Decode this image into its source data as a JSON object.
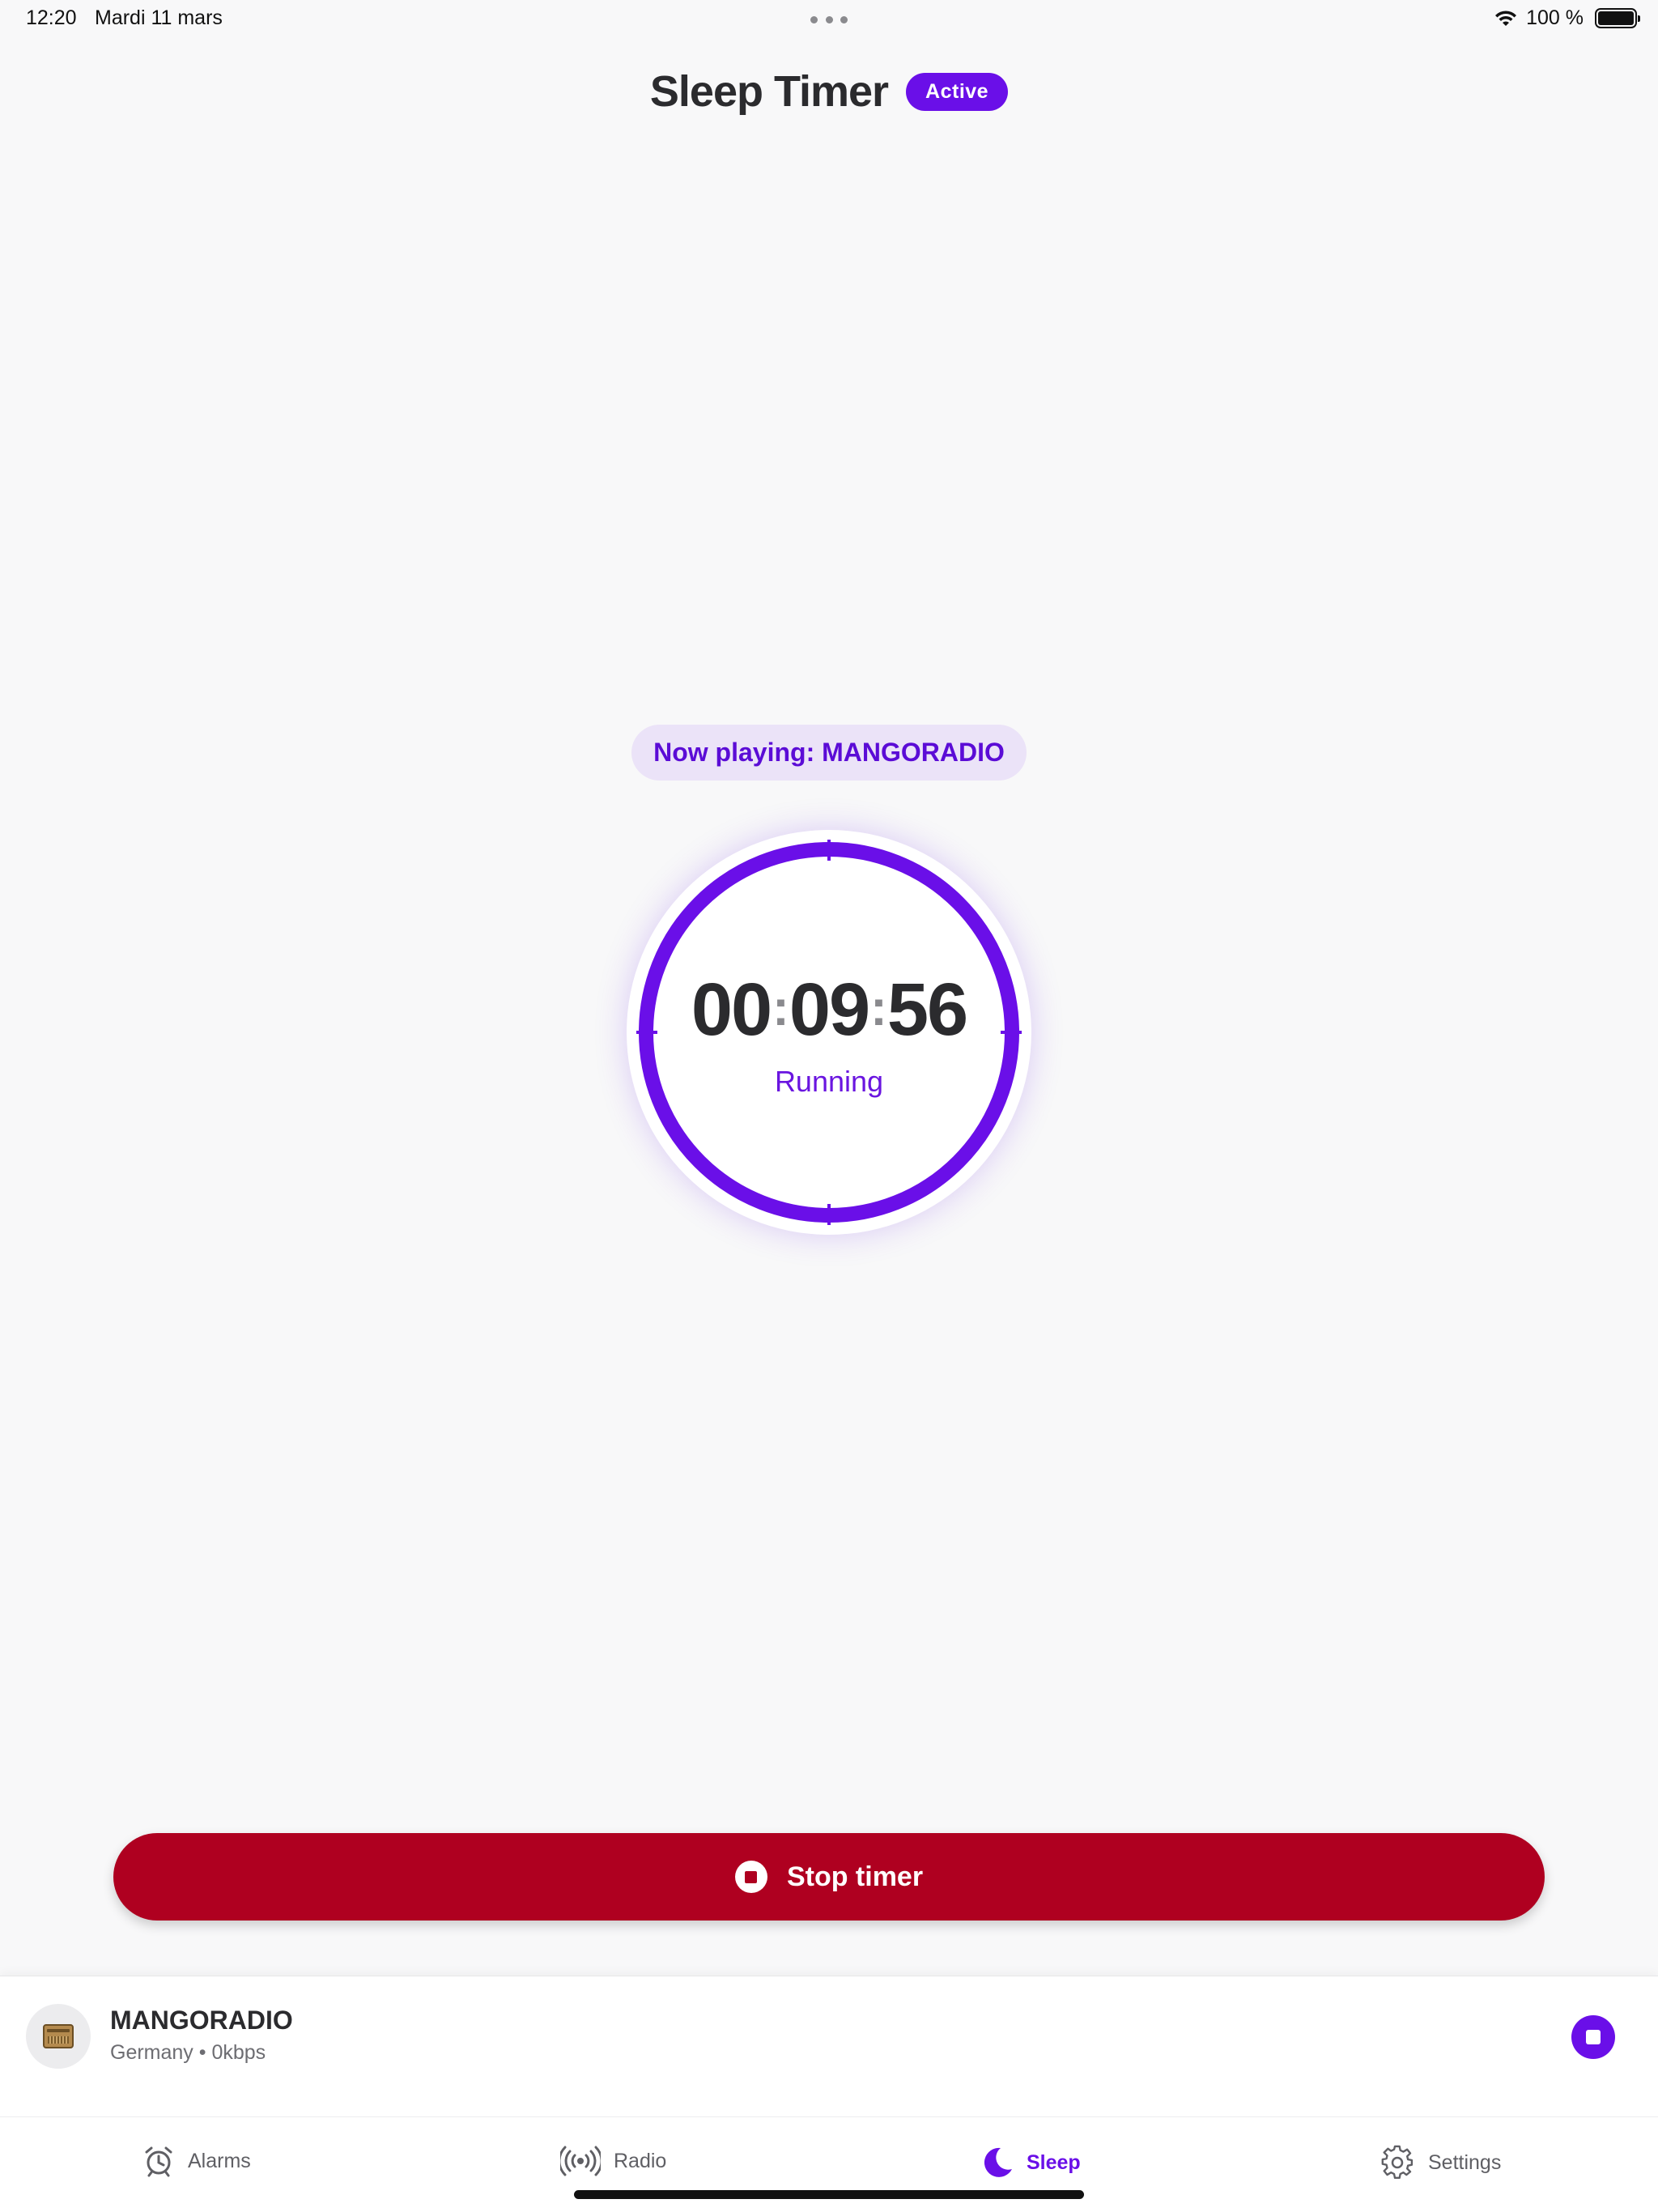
{
  "status_bar": {
    "time": "12:20",
    "date": "Mardi 11 mars",
    "battery": "100 %"
  },
  "header": {
    "title": "Sleep Timer",
    "badge": "Active"
  },
  "now_playing": {
    "label": "Now playing: MANGORADIO"
  },
  "timer": {
    "hours": "00",
    "minutes": "09",
    "seconds": "56",
    "status": "Running",
    "progress": 1.0
  },
  "actions": {
    "stop_label": "Stop timer"
  },
  "player": {
    "station": "MANGORADIO",
    "meta": "Germany • 0kbps"
  },
  "tabs": [
    {
      "label": "Alarms",
      "icon": "alarm-clock-icon"
    },
    {
      "label": "Radio",
      "icon": "radio-broadcast-icon"
    },
    {
      "label": "Sleep",
      "icon": "moon-icon"
    },
    {
      "label": "Settings",
      "icon": "gear-icon"
    }
  ],
  "colors": {
    "accent": "#6a0fe8",
    "danger": "#af0020",
    "pill_bg": "#ebe3f8",
    "background": "#f8f8f9"
  }
}
